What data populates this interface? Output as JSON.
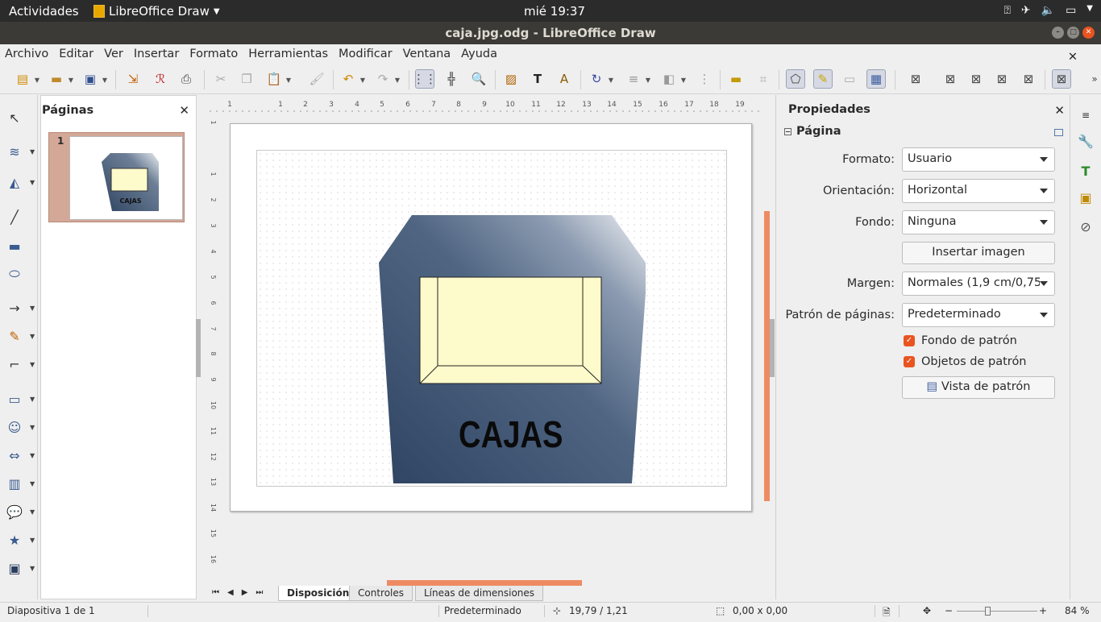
{
  "system": {
    "activities": "Actividades",
    "app_name": "LibreOffice Draw",
    "clock": "mié 19:37"
  },
  "window": {
    "title": "caja.jpg.odg - LibreOffice Draw"
  },
  "menu": [
    "Archivo",
    "Editar",
    "Ver",
    "Insertar",
    "Formato",
    "Herramientas",
    "Modificar",
    "Ventana",
    "Ayuda"
  ],
  "pages_panel": {
    "title": "Páginas",
    "page_number": "1",
    "thumb_text": "CAJAS"
  },
  "drawing": {
    "text": "CAJAS",
    "colors": {
      "box_dark": "#2f4462",
      "box_light": "#e9ecf0",
      "window_fill": "#fdfacb",
      "accent": "#ee8b63"
    }
  },
  "tabs": [
    "Disposición",
    "Controles",
    "Líneas de dimensiones"
  ],
  "sidebar": {
    "title": "Propiedades",
    "section": "Página",
    "format_label": "Formato:",
    "format_value": "Usuario",
    "orientation_label": "Orientación:",
    "orientation_value": "Horizontal",
    "background_label": "Fondo:",
    "background_value": "Ninguna",
    "insert_image": "Insertar imagen",
    "margin_label": "Margen:",
    "margin_value": "Normales (1,9 cm/0,75",
    "master_label": "Patrón de páginas:",
    "master_value": "Predeterminado",
    "master_bg": "Fondo de patrón",
    "master_objects": "Objetos de patrón",
    "master_view": "Vista de patrón"
  },
  "ruler_h": [
    "1",
    "1",
    "2",
    "3",
    "4",
    "5",
    "6",
    "7",
    "8",
    "9",
    "10",
    "11",
    "12",
    "13",
    "14",
    "15",
    "16",
    "17",
    "18",
    "19"
  ],
  "ruler_v": [
    "1",
    "1",
    "2",
    "3",
    "4",
    "5",
    "6",
    "7",
    "8",
    "9",
    "10",
    "11",
    "12",
    "13",
    "14",
    "15",
    "16"
  ],
  "status": {
    "slide": "Diapositiva 1 de 1",
    "master": "Predeterminado",
    "position": "19,79 / 1,21",
    "size": "0,00 x 0,00",
    "zoom": "84 %"
  }
}
